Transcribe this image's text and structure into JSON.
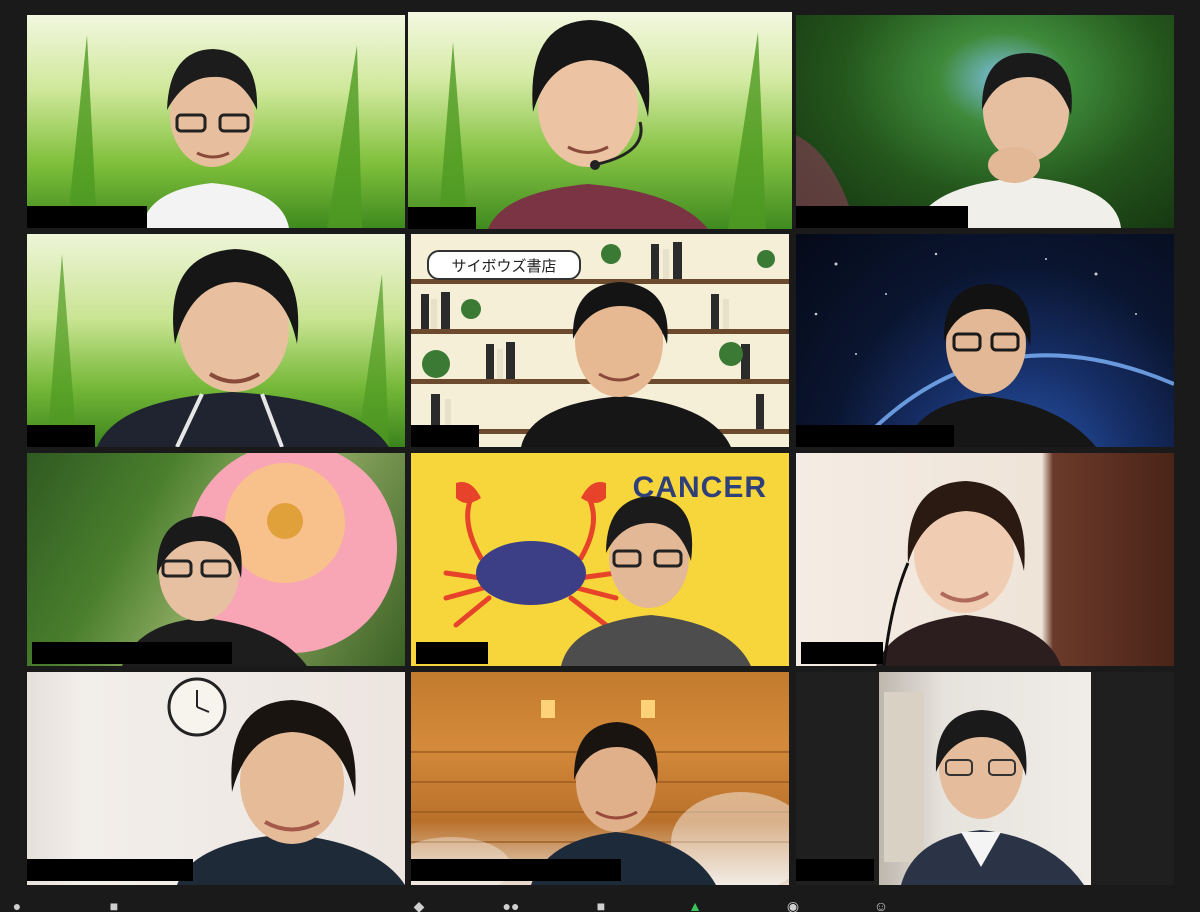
{
  "app": {
    "name": "video-meeting-gallery-view"
  },
  "tiles": [
    {
      "id": "t1",
      "background": "grass",
      "name_redacted": true
    },
    {
      "id": "t2",
      "background": "grass",
      "active_speaker": true,
      "headset": true,
      "name_redacted": true
    },
    {
      "id": "t3",
      "background": "forest",
      "name_redacted": true
    },
    {
      "id": "t4",
      "background": "grass",
      "name_redacted": true
    },
    {
      "id": "t5",
      "background": "bookstore",
      "sign_text": "サイボウズ書店",
      "name_redacted": true
    },
    {
      "id": "t6",
      "background": "space-earth",
      "name_redacted": true
    },
    {
      "id": "t7",
      "background": "rose",
      "name_redacted": true
    },
    {
      "id": "t8",
      "background": "cancer-crab",
      "bg_text": "CANCER",
      "name_redacted": true
    },
    {
      "id": "t9",
      "background": "room",
      "headset": true,
      "name_redacted": true
    },
    {
      "id": "t10",
      "background": "clock-wall",
      "name_redacted": true
    },
    {
      "id": "t11",
      "background": "sauna",
      "name_redacted": true
    },
    {
      "id": "t12",
      "background": "office",
      "name_redacted": true
    }
  ],
  "toolbar": {
    "icons": [
      "mute-icon",
      "video-icon",
      "security-icon",
      "participants-icon",
      "chat-icon",
      "share-screen-icon",
      "record-icon",
      "reactions-icon"
    ]
  },
  "colors": {
    "active_border": "#e8ef57",
    "frame": "#1a1a1a",
    "share_green": "#3bc45a",
    "cancer_bg": "#f6d63a",
    "cancer_text": "#2f3f7a"
  }
}
